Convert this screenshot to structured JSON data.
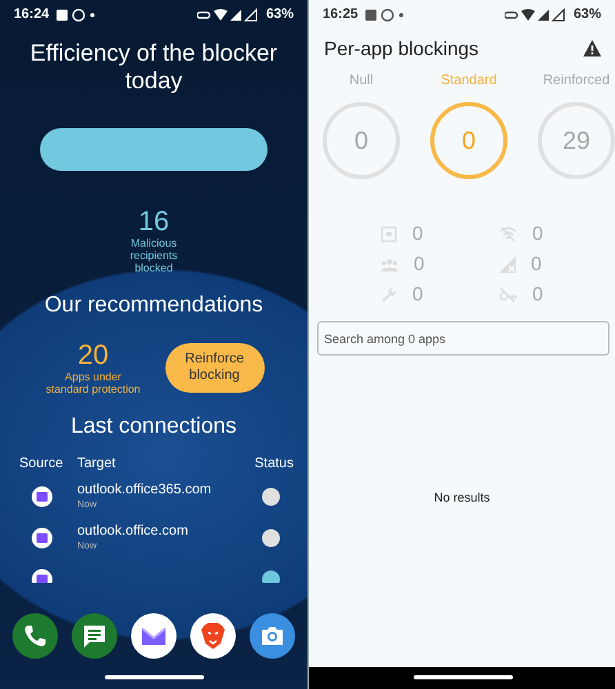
{
  "left": {
    "status_bar": {
      "time": "16:24",
      "battery": "63%"
    },
    "title": "Efficiency of the blocker today",
    "blocked": {
      "count": "16",
      "label": "Malicious recipients blocked"
    },
    "recommendations": {
      "title": "Our recommendations",
      "count": "20",
      "label": "Apps under standard protection",
      "button": "Reinforce blocking"
    },
    "connections": {
      "title": "Last connections",
      "columns": [
        "Source",
        "Target",
        "Status"
      ],
      "rows": [
        {
          "target": "outlook.office365.com",
          "time": "Now",
          "color": "#e0e0e0"
        },
        {
          "target": "outlook.office.com",
          "time": "Now",
          "color": "#e0e0e0"
        },
        {
          "color": "#6ec6dc"
        }
      ]
    },
    "dock": [
      {
        "kind": "phone"
      },
      {
        "kind": "chat"
      },
      {
        "kind": "mail"
      },
      {
        "kind": "lion"
      },
      {
        "kind": "camera"
      }
    ]
  },
  "right": {
    "status_bar": {
      "time": "16:25",
      "battery": "63%"
    },
    "title": "Per-app blockings",
    "levels": [
      {
        "label": "Null",
        "value": "0",
        "selected": false
      },
      {
        "label": "Standard",
        "value": "0",
        "selected": true
      },
      {
        "label": "Reinforced",
        "value": "29",
        "selected": false
      }
    ],
    "stats": [
      {
        "kind": "calendar",
        "value": "0"
      },
      {
        "kind": "wifi-off",
        "value": "0"
      },
      {
        "kind": "people",
        "value": "0"
      },
      {
        "kind": "signal-off",
        "value": "0"
      },
      {
        "kind": "wrench",
        "value": "0"
      },
      {
        "kind": "key-off",
        "value": "0"
      }
    ],
    "search": {
      "placeholder": "Search among 0 apps"
    },
    "empty": "No results"
  }
}
